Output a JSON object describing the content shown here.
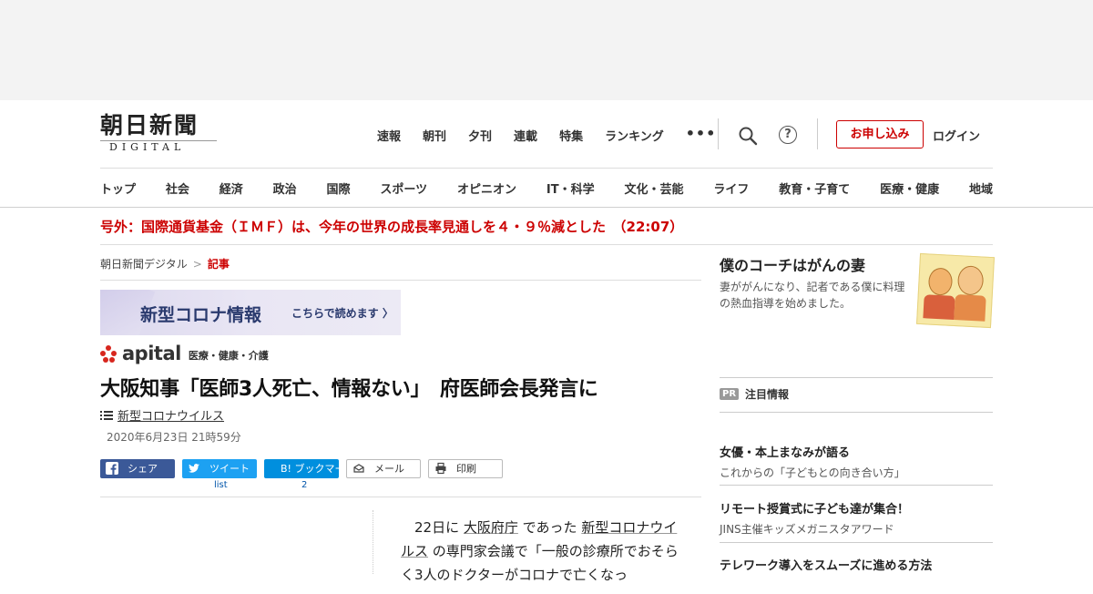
{
  "header": {
    "logo_kanji": "朝日新聞",
    "logo_digital": "DIGITAL",
    "top_nav": [
      "速報",
      "朝刊",
      "夕刊",
      "連載",
      "特集",
      "ランキング"
    ],
    "more_label": "•••",
    "help_label": "?",
    "apply_label": "お申し込み",
    "login_label": "ログイン",
    "categories": [
      "トップ",
      "社会",
      "経済",
      "政治",
      "国際",
      "スポーツ",
      "オピニオン",
      "IT・科学",
      "文化・芸能",
      "ライフ",
      "教育・子育て",
      "医療・健康",
      "地域"
    ]
  },
  "breaking": {
    "text": "号外：国際通貨基金（ＩＭＦ）は、今年の世界の成長率見通しを４・９％減とした　（22:07）"
  },
  "breadcrumb": {
    "home": "朝日新聞デジタル",
    "sep": ">",
    "current": "記事"
  },
  "banner": {
    "title": "新型コロナ情報",
    "link": "こちらで読めます 〉"
  },
  "apital": {
    "brand": "apital",
    "sub": "医療・健康・介護"
  },
  "article": {
    "headline": "大阪知事「医師3人死亡、情報ない」　府医師会長発言に",
    "tag": "新型コロナウイルス",
    "date": "2020年6月23日 21時59分",
    "body_lead": "22日に",
    "body_link1": "大阪府庁",
    "body_mid": "であった",
    "body_link2": "新型コロナウイルス",
    "body_rest": "の専門家会議で「一般の診療所でおそらく3人のドクターがコロナで亡くなっ"
  },
  "share": {
    "facebook": "シェア",
    "twitter": "ツイート",
    "hatena": "B! ブックマーク",
    "mail": "メール",
    "print": "印刷",
    "twitter_count": "list",
    "hatena_count": "2"
  },
  "sidebar": {
    "coach_title": "僕のコーチはがんの妻",
    "coach_desc": "妻ががんになり、記者である僕に料理の熱血指導を始めました。",
    "pr_badge": "PR",
    "pr_heading": "注目情報",
    "pr_items": [
      {
        "title": "女優・本上まなみが語る",
        "sub": "これからの「子どもとの向き合い方」"
      },
      {
        "title": "リモート授賞式に子ども達が集合！",
        "sub": "JINS主催キッズメガニスタアワード"
      },
      {
        "title": "テレワーク導入をスムーズに進める方法",
        "sub": ""
      }
    ]
  },
  "colors": {
    "accent_red": "#cc0000",
    "facebook": "#3b5998",
    "twitter": "#1da1f2",
    "hatena": "#008fde"
  }
}
